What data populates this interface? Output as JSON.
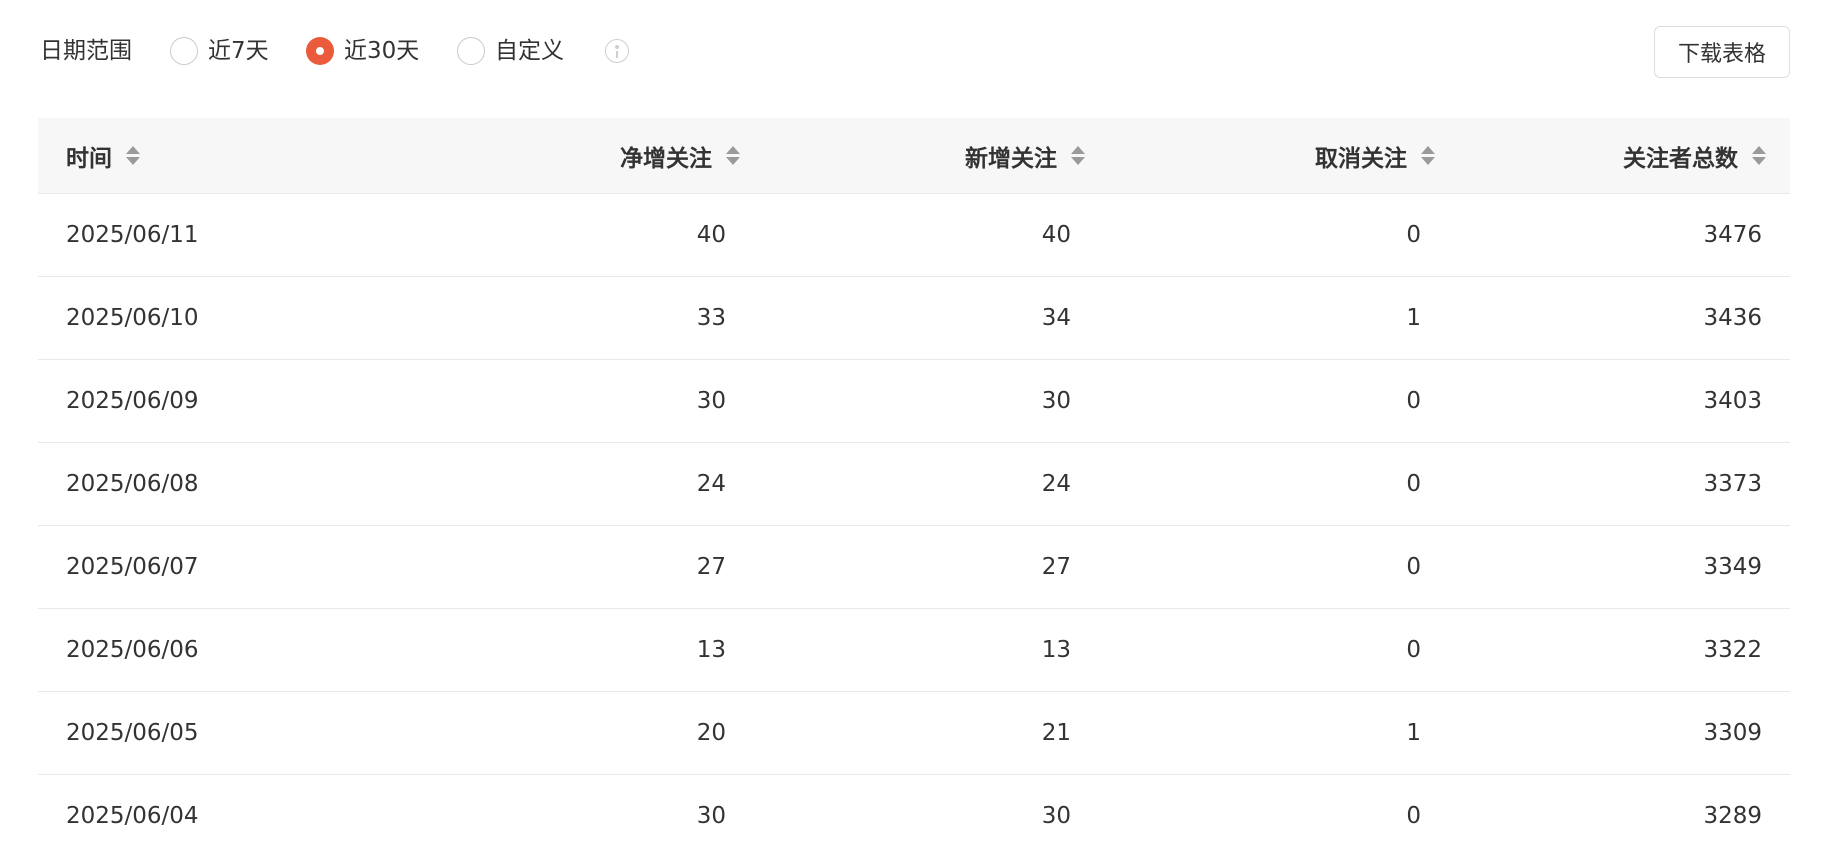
{
  "filter": {
    "label": "日期范围",
    "options": [
      {
        "label": "近7天",
        "checked": false
      },
      {
        "label": "近30天",
        "checked": true
      },
      {
        "label": "自定义",
        "checked": false
      }
    ],
    "info_icon": "info-icon",
    "accent_color": "#ec5a3c"
  },
  "toolbar": {
    "download_label": "下载表格"
  },
  "table": {
    "columns": [
      "时间",
      "净增关注",
      "新增关注",
      "取消关注",
      "关注者总数"
    ],
    "rows": [
      {
        "date": "2025/06/11",
        "net": "40",
        "new": "40",
        "cancel": "0",
        "total": "3476"
      },
      {
        "date": "2025/06/10",
        "net": "33",
        "new": "34",
        "cancel": "1",
        "total": "3436"
      },
      {
        "date": "2025/06/09",
        "net": "30",
        "new": "30",
        "cancel": "0",
        "total": "3403"
      },
      {
        "date": "2025/06/08",
        "net": "24",
        "new": "24",
        "cancel": "0",
        "total": "3373"
      },
      {
        "date": "2025/06/07",
        "net": "27",
        "new": "27",
        "cancel": "0",
        "total": "3349"
      },
      {
        "date": "2025/06/06",
        "net": "13",
        "new": "13",
        "cancel": "0",
        "total": "3322"
      },
      {
        "date": "2025/06/05",
        "net": "20",
        "new": "21",
        "cancel": "1",
        "total": "3309"
      },
      {
        "date": "2025/06/04",
        "net": "30",
        "new": "30",
        "cancel": "0",
        "total": "3289"
      }
    ]
  }
}
